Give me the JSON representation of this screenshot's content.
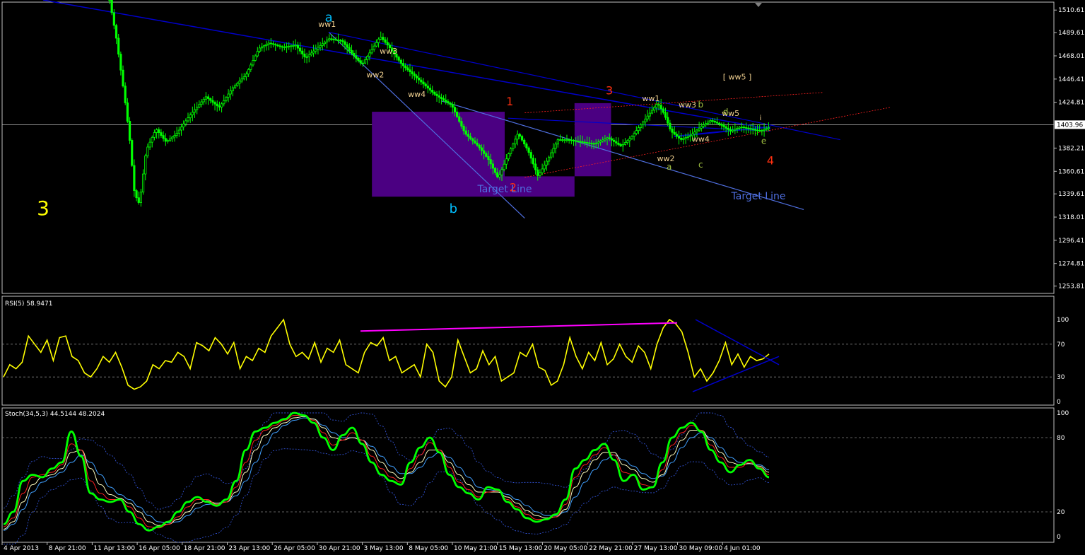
{
  "chart_data": [
    {
      "type": "candlestick",
      "symbol_price_scale": [
        "1510.61",
        "1489.61",
        "1468.01",
        "1446.41",
        "1424.81",
        "1403.96",
        "1382.21",
        "1360.61",
        "1339.61",
        "1318.01",
        "1296.41",
        "1274.81",
        "1253.81"
      ],
      "price_range": [
        1247,
        1518
      ],
      "current_price": "1403.96",
      "current_price_value": 1403.96,
      "colors": {
        "up": "#00ff00",
        "down": "#00ff00",
        "grid": "#c0c0c0",
        "trendline": "#0000cc",
        "lightline": "#4f6fe0",
        "box": "#4b0082",
        "redline": "#ff2020"
      },
      "price_path": [
        [
          0,
          1520
        ],
        [
          4,
          1485
        ],
        [
          9,
          1430
        ],
        [
          12,
          1392
        ],
        [
          15,
          1340
        ],
        [
          18,
          1330
        ],
        [
          22,
          1380
        ],
        [
          28,
          1400
        ],
        [
          34,
          1388
        ],
        [
          40,
          1395
        ],
        [
          48,
          1412
        ],
        [
          58,
          1430
        ],
        [
          66,
          1420
        ],
        [
          74,
          1438
        ],
        [
          82,
          1450
        ],
        [
          90,
          1475
        ],
        [
          96,
          1480
        ],
        [
          104,
          1476
        ],
        [
          112,
          1478
        ],
        [
          118,
          1466
        ],
        [
          124,
          1474
        ],
        [
          132,
          1484
        ],
        [
          140,
          1482
        ],
        [
          146,
          1470
        ],
        [
          152,
          1460
        ],
        [
          158,
          1474
        ],
        [
          163,
          1486
        ],
        [
          168,
          1477
        ],
        [
          176,
          1460
        ],
        [
          186,
          1446
        ],
        [
          196,
          1432
        ],
        [
          206,
          1422
        ],
        [
          214,
          1396
        ],
        [
          222,
          1384
        ],
        [
          228,
          1372
        ],
        [
          234,
          1354
        ],
        [
          240,
          1376
        ],
        [
          246,
          1396
        ],
        [
          252,
          1380
        ],
        [
          258,
          1356
        ],
        [
          264,
          1372
        ],
        [
          270,
          1390
        ],
        [
          276,
          1390
        ],
        [
          284,
          1388
        ],
        [
          292,
          1386
        ],
        [
          300,
          1392
        ],
        [
          308,
          1384
        ],
        [
          314,
          1392
        ],
        [
          320,
          1404
        ],
        [
          326,
          1416
        ],
        [
          330,
          1424
        ],
        [
          334,
          1414
        ],
        [
          338,
          1398
        ],
        [
          344,
          1390
        ],
        [
          350,
          1394
        ],
        [
          356,
          1402
        ],
        [
          362,
          1408
        ],
        [
          368,
          1404
        ],
        [
          374,
          1398
        ],
        [
          380,
          1402
        ],
        [
          386,
          1400
        ],
        [
          392,
          1398
        ],
        [
          398,
          1402
        ]
      ],
      "wave_labels": [
        {
          "text": "3",
          "color": "#ffff00",
          "size": 28
        },
        {
          "text": "a",
          "color": "#00bfff",
          "size": 18
        },
        {
          "text": "b",
          "color": "#00bfff",
          "size": 18
        },
        {
          "text": "1",
          "color": "#ff3010",
          "size": 16
        },
        {
          "text": "2",
          "color": "#ff3010",
          "size": 16
        },
        {
          "text": "3",
          "color": "#ff3010",
          "size": 16
        },
        {
          "text": "4",
          "color": "#ff3010",
          "size": 16
        },
        {
          "text": "ww1",
          "color": "#f0d090",
          "size": 11
        },
        {
          "text": "ww2",
          "color": "#f0d090",
          "size": 11
        },
        {
          "text": "ww3",
          "color": "#f0d090",
          "size": 11
        },
        {
          "text": "ww4",
          "color": "#f0d090",
          "size": 11
        },
        {
          "text": "ww1",
          "color": "#f0d090",
          "size": 11
        },
        {
          "text": "ww2",
          "color": "#f0d090",
          "size": 11
        },
        {
          "text": "ww3",
          "color": "#f0d090",
          "size": 11
        },
        {
          "text": "ww4",
          "color": "#f0d090",
          "size": 11
        },
        {
          "text": "ww5",
          "color": "#f0d090",
          "size": 11
        },
        {
          "text": "[ ww5 ]",
          "color": "#f0d090",
          "size": 11
        },
        {
          "text": "a",
          "color": "#a0c040",
          "size": 12
        },
        {
          "text": "b",
          "color": "#a0c040",
          "size": 12
        },
        {
          "text": "c",
          "color": "#a0c040",
          "size": 12
        },
        {
          "text": "d",
          "color": "#a0c040",
          "size": 12
        },
        {
          "text": "e",
          "color": "#a0c040",
          "size": 12
        },
        {
          "text": "i",
          "color": "#f0d090",
          "size": 10
        }
      ],
      "target_labels": [
        "Target Line",
        "Target Line"
      ]
    },
    {
      "type": "line",
      "title": "RSI(5) 58.9471",
      "y_ticks": [
        "100",
        "70",
        "30",
        "0"
      ],
      "ylim": [
        0,
        100
      ],
      "levels": [
        70,
        30
      ],
      "series": [
        {
          "color": "#ffff00",
          "values": [
            30,
            45,
            40,
            48,
            80,
            70,
            60,
            75,
            50,
            78,
            80,
            55,
            50,
            35,
            30,
            40,
            55,
            48,
            60,
            42,
            20,
            15,
            18,
            25,
            45,
            40,
            50,
            48,
            60,
            55,
            40,
            72,
            68,
            62,
            78,
            70,
            58,
            72,
            40,
            55,
            50,
            65,
            60,
            80,
            90,
            100,
            70,
            55,
            60,
            52,
            72,
            48,
            65,
            60,
            75,
            45,
            40,
            35,
            60,
            72,
            68,
            78,
            50,
            55,
            35,
            40,
            45,
            30,
            70,
            60,
            25,
            18,
            30,
            75,
            55,
            35,
            40,
            62,
            45,
            55,
            25,
            30,
            35,
            60,
            55,
            70,
            42,
            38,
            20,
            25,
            45,
            78,
            55,
            40,
            60,
            50,
            72,
            45,
            52,
            70,
            55,
            48,
            68,
            60,
            40,
            70,
            90,
            100,
            95,
            85,
            60,
            30,
            40,
            25,
            35,
            50,
            72,
            45,
            58,
            42,
            55,
            50,
            52,
            58
          ]
        }
      ],
      "trendline_color": "#ff00ff"
    },
    {
      "type": "line",
      "title": "Stoch(34,5,3) 44.5144 48.2024",
      "y_ticks": [
        "100",
        "80",
        "20",
        "0"
      ],
      "ylim": [
        0,
        100
      ],
      "levels": [
        80,
        20
      ],
      "series": [
        {
          "color": "#00ff00",
          "values": [
            10,
            20,
            45,
            50,
            48,
            55,
            60,
            85,
            65,
            35,
            30,
            28,
            30,
            20,
            10,
            5,
            8,
            12,
            20,
            28,
            32,
            28,
            25,
            30,
            45,
            70,
            85,
            88,
            92,
            95,
            100,
            98,
            92,
            80,
            70,
            82,
            88,
            75,
            60,
            50,
            45,
            42,
            60,
            72,
            80,
            68,
            50,
            40,
            35,
            30,
            40,
            38,
            28,
            22,
            15,
            12,
            14,
            18,
            30,
            55,
            62,
            70,
            75,
            62,
            45,
            50,
            38,
            40,
            60,
            80,
            88,
            92,
            85,
            70,
            60,
            52,
            58,
            62,
            55,
            48
          ]
        },
        {
          "color": "#ff2020",
          "values": [
            8,
            15,
            35,
            48,
            50,
            52,
            58,
            75,
            70,
            45,
            35,
            30,
            30,
            24,
            15,
            8,
            7,
            10,
            16,
            24,
            30,
            30,
            26,
            28,
            40,
            60,
            78,
            86,
            90,
            94,
            98,
            98,
            94,
            84,
            74,
            78,
            84,
            78,
            65,
            55,
            48,
            44,
            55,
            66,
            76,
            70,
            56,
            44,
            38,
            32,
            36,
            37,
            30,
            24,
            18,
            14,
            14,
            16,
            26,
            48,
            58,
            66,
            72,
            66,
            52,
            50,
            42,
            40,
            54,
            74,
            84,
            90,
            86,
            74,
            64,
            56,
            56,
            60,
            56,
            50
          ]
        },
        {
          "color": "#ffffc0",
          "values": [
            6,
            12,
            28,
            42,
            48,
            50,
            55,
            68,
            70,
            55,
            42,
            34,
            31,
            27,
            20,
            12,
            9,
            10,
            14,
            20,
            27,
            29,
            27,
            28,
            36,
            52,
            70,
            82,
            88,
            92,
            96,
            97,
            95,
            88,
            80,
            78,
            80,
            78,
            70,
            60,
            52,
            47,
            52,
            60,
            70,
            70,
            60,
            50,
            42,
            36,
            36,
            36,
            32,
            27,
            21,
            17,
            15,
            16,
            22,
            40,
            52,
            62,
            68,
            68,
            58,
            54,
            47,
            44,
            50,
            66,
            78,
            86,
            86,
            78,
            68,
            60,
            58,
            59,
            57,
            52
          ]
        },
        {
          "color": "#40a0ff",
          "values": [
            5,
            10,
            22,
            36,
            44,
            48,
            52,
            60,
            66,
            60,
            50,
            40,
            34,
            30,
            24,
            17,
            12,
            11,
            12,
            17,
            23,
            26,
            27,
            28,
            33,
            45,
            60,
            74,
            84,
            90,
            94,
            96,
            95,
            90,
            84,
            80,
            80,
            78,
            73,
            65,
            57,
            51,
            51,
            56,
            64,
            68,
            64,
            56,
            48,
            40,
            38,
            37,
            34,
            30,
            25,
            20,
            17,
            17,
            20,
            32,
            44,
            54,
            62,
            66,
            62,
            57,
            51,
            47,
            49,
            60,
            72,
            80,
            84,
            80,
            72,
            64,
            60,
            59,
            58,
            54
          ]
        }
      ],
      "band_color": "#3050d0"
    }
  ],
  "x_axis_labels": [
    "4 Apr 2013",
    "8 Apr 21:00",
    "11 Apr 13:00",
    "16 Apr 05:00",
    "18 Apr 21:00",
    "23 Apr 13:00",
    "26 Apr 05:00",
    "30 Apr 21:00",
    "3 May 13:00",
    "8 May 05:00",
    "10 May 21:00",
    "15 May 13:00",
    "20 May 05:00",
    "22 May 21:00",
    "27 May 13:00",
    "30 May 09:00",
    "4 Jun 01:00"
  ]
}
